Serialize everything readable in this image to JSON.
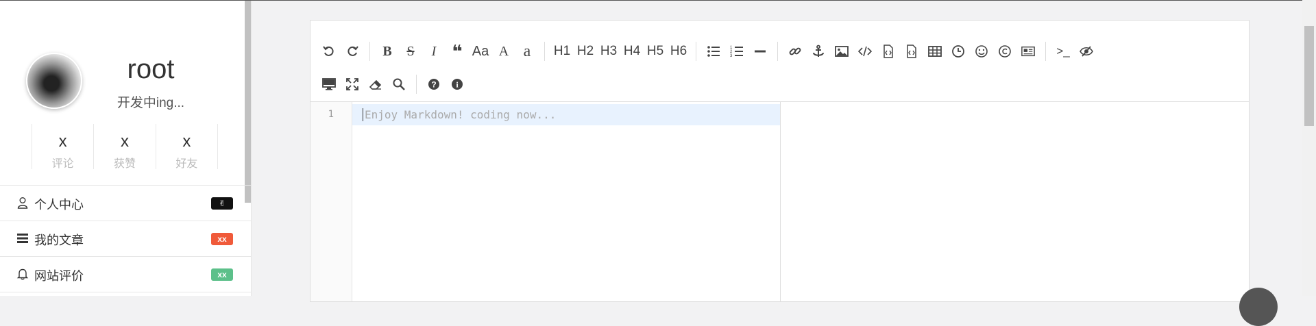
{
  "profile": {
    "username": "root",
    "tagline": "开发中ing...",
    "stats": [
      {
        "value": "x",
        "label": "评论"
      },
      {
        "value": "x",
        "label": "获赞"
      },
      {
        "value": "x",
        "label": "好友"
      }
    ]
  },
  "menu": [
    {
      "label": "个人中心",
      "icon": "user-icon",
      "badge": "✌",
      "badge_color": "#111111"
    },
    {
      "label": "我的文章",
      "icon": "list-icon",
      "badge": "xx",
      "badge_color": "#f05a3a"
    },
    {
      "label": "网站评价",
      "icon": "bell-icon",
      "badge": "xx",
      "badge_color": "#5cc08a"
    }
  ],
  "toolbar": {
    "headings": [
      "H1",
      "H2",
      "H3",
      "H4",
      "H5",
      "H6"
    ],
    "font_case_label": "Aa",
    "uppercase_label": "A",
    "lowercase_label": "a",
    "code_block_label": ">_"
  },
  "editor": {
    "line_number": "1",
    "placeholder": "Enjoy Markdown! coding now..."
  },
  "colors": {
    "accent_bg": "#e8f2fe",
    "border": "#dddddd"
  }
}
